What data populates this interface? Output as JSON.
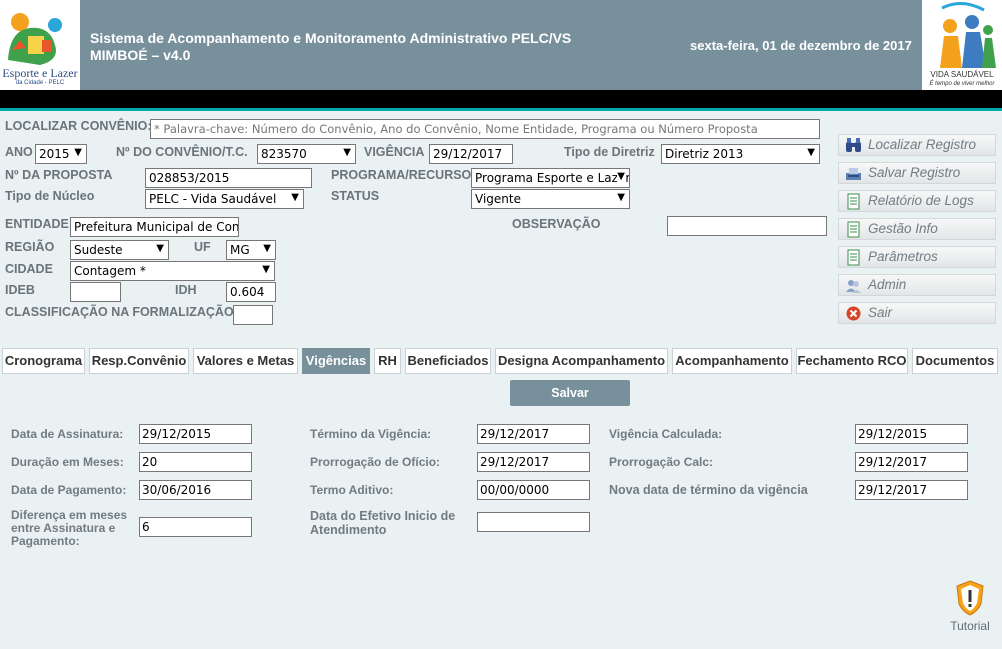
{
  "header": {
    "logo_left_text": [
      "Esporte e Lazer",
      "da Cidade - PELC"
    ],
    "title_line1": "Sistema de Acompanhamento e Monitoramento Administrativo PELC/VS",
    "title_line2": "MIMBOÉ – v4.0",
    "date": "sexta-feira, 01 de dezembro de 2017",
    "logo_right_text": [
      "VIDA SAUDÁVEL",
      "É tempo de viver melhor"
    ]
  },
  "form": {
    "localizar_label": "LOCALIZAR CONVÊNIO:",
    "localizar_placeholder": "* Palavra-chave: Número do Convênio, Ano do Convênio, Nome Entidade, Programa ou Número Proposta",
    "ano_label": "ANO",
    "ano_value": "2015",
    "convenio_label": "Nº DO CONVÊNIO/T.C.",
    "convenio_value": "823570",
    "vigencia_label": "VIGÊNCIA",
    "vigencia_value": "29/12/2017",
    "tipo_diretriz_label": "Tipo de Diretriz",
    "tipo_diretriz_value": "Diretriz 2013",
    "proposta_label": "Nº DA PROPOSTA",
    "proposta_value": "028853/2015",
    "programa_label": "PROGRAMA/RECURSO",
    "programa_value": "Programa Esporte e Lazer",
    "tipo_nucleo_label": "Tipo de Núcleo",
    "tipo_nucleo_value": "PELC - Vida Saudável",
    "status_label": "STATUS",
    "status_value": "Vigente",
    "entidade_label": "ENTIDADE",
    "entidade_value": "Prefeitura Municipal de Contag",
    "observacao_label": "OBSERVAÇÃO",
    "regiao_label": "REGIÃO",
    "regiao_value": "Sudeste",
    "uf_label": "UF",
    "uf_value": "MG",
    "cidade_label": "CIDADE",
    "cidade_value": "Contagem *",
    "ideb_label": "IDEB",
    "idh_label": "IDH",
    "idh_value": "0.604",
    "classificacao_label": "CLASSIFICAÇÃO NA FORMALIZAÇÃO"
  },
  "menu": [
    {
      "label": "Localizar Registro",
      "icon": "binoculars-icon"
    },
    {
      "label": "Salvar Registro",
      "icon": "save-icon"
    },
    {
      "label": "Relatório de Logs",
      "icon": "document-icon"
    },
    {
      "label": "Gestão Info",
      "icon": "document-icon"
    },
    {
      "label": "Parâmetros",
      "icon": "document-icon"
    },
    {
      "label": "Admin",
      "icon": "users-icon"
    },
    {
      "label": "Sair",
      "icon": "close-icon"
    }
  ],
  "tabs": [
    "Cronograma",
    "Resp.Convênio",
    "Valores e Metas",
    "Vigências",
    "RH",
    "Beneficiados",
    "Designa Acompanhamento",
    "Acompanhamento",
    "Fechamento RCO",
    "Documentos"
  ],
  "active_tab": "Vigências",
  "save_label": "Salvar",
  "vigencias": {
    "data_assinatura_label": "Data de Assinatura:",
    "data_assinatura": "29/12/2015",
    "duracao_label": "Duração em Meses:",
    "duracao": "20",
    "data_pagamento_label": "Data de Pagamento:",
    "data_pagamento": "30/06/2016",
    "diferenca_label": [
      "Diferença em meses",
      "entre Assinatura e",
      "Pagamento:"
    ],
    "diferenca": "6",
    "termino_label": "Término da Vigência:",
    "termino": "29/12/2017",
    "prorrogacao_oficio_label": "Prorrogação de Ofício:",
    "prorrogacao_oficio": "29/12/2017",
    "termo_aditivo_label": "Termo Aditivo:",
    "termo_aditivo": "00/00/0000",
    "efetivo_inicio_label": [
      "Data do Efetivo Inicio de",
      "Atendimento"
    ],
    "vigencia_calculada_label": "Vigência Calculada:",
    "vigencia_calculada": "29/12/2015",
    "prorrogacao_calc_label": "Prorrogação Calc:",
    "prorrogacao_calc": "29/12/2017",
    "nova_data_label": "Nova data de término da vigência",
    "nova_data": "29/12/2017"
  },
  "tutorial_label": "Tutorial",
  "colors": {
    "header": "#78909c",
    "accent": "#00aaa8",
    "background": "#e9f1f3"
  }
}
